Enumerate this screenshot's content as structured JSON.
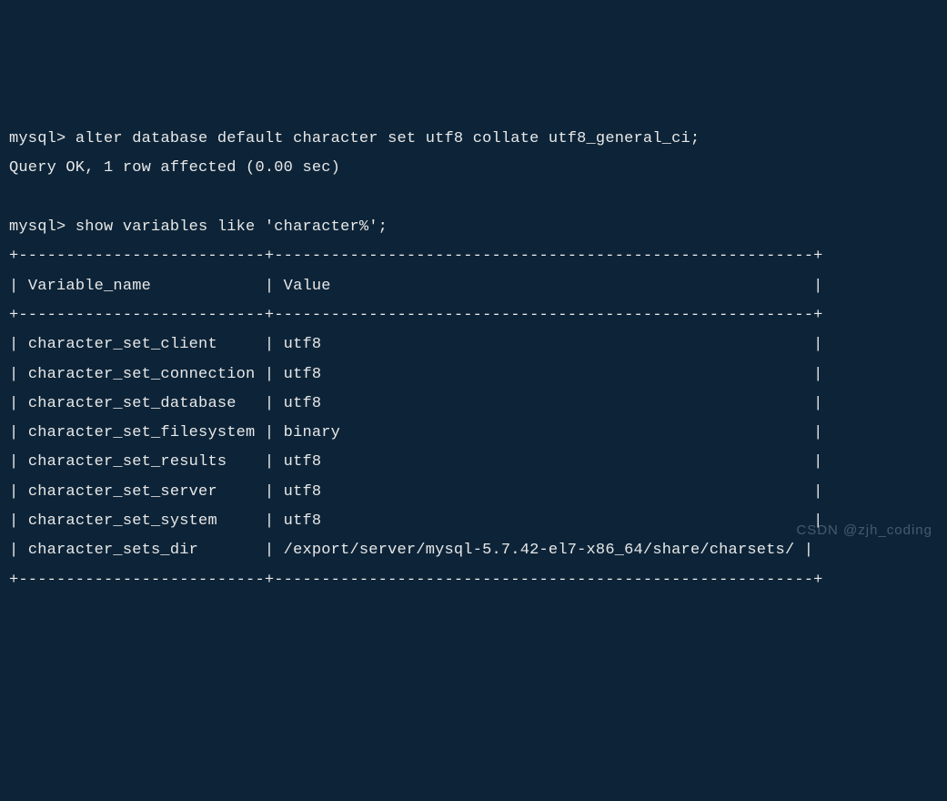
{
  "prompt": "mysql>",
  "commands": {
    "cmd1": "alter database default character set utf8 collate utf8_general_ci;",
    "result1": "Query OK, 1 row affected (0.00 sec)",
    "cmd2": "show variables like 'character%';"
  },
  "table": {
    "border_top": "+--------------------------+---------------------------------------------------------+",
    "header_col1": "Variable_name",
    "header_col2": "Value",
    "rows": [
      {
        "name": "character_set_client",
        "value": "utf8"
      },
      {
        "name": "character_set_connection",
        "value": "utf8"
      },
      {
        "name": "character_set_database",
        "value": "utf8"
      },
      {
        "name": "character_set_filesystem",
        "value": "binary"
      },
      {
        "name": "character_set_results",
        "value": "utf8"
      },
      {
        "name": "character_set_server",
        "value": "utf8"
      },
      {
        "name": "character_set_system",
        "value": "utf8"
      },
      {
        "name": "character_sets_dir",
        "value": "/export/server/mysql-5.7.42-el7-x86_64/share/charsets/"
      }
    ]
  },
  "watermark": "CSDN @zjh_coding"
}
